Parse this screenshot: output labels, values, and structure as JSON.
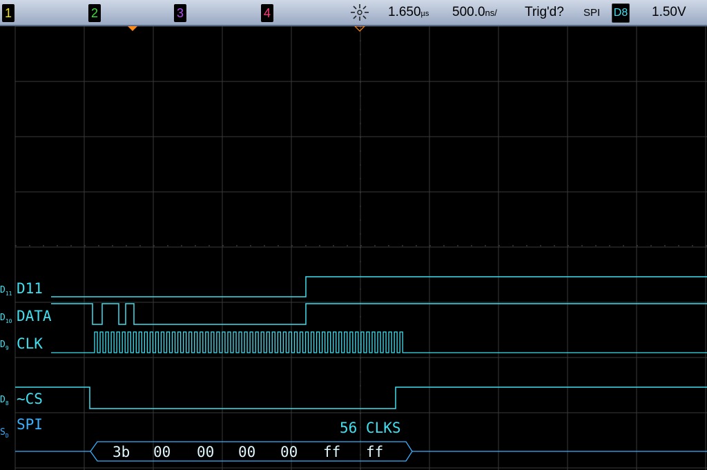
{
  "toolbar": {
    "channels": [
      {
        "label": "1",
        "color": "#f5e31a"
      },
      {
        "label": "2",
        "color": "#36e236"
      },
      {
        "label": "3",
        "color": "#b44cf0"
      },
      {
        "label": "4",
        "color": "#ff3c7d"
      }
    ],
    "delay": "1.650",
    "delay_unit": "µs",
    "timebase": "500.0",
    "timebase_unit": "ns/",
    "trigger_status": "Trig'd?",
    "trigger_type": "SPI",
    "trigger_source": "D8",
    "trigger_level": "1.50V"
  },
  "traces": {
    "d11": {
      "id": "D11",
      "label": "D11"
    },
    "d10": {
      "id": "D10",
      "label": "DATA"
    },
    "d9": {
      "id": "D9",
      "label": "CLK"
    },
    "d8": {
      "id": "D8",
      "label": "~CS"
    },
    "sd": {
      "id": "SD",
      "label": "SPI"
    }
  },
  "decode": {
    "clock_count": "56 CLKS",
    "bytes": [
      "3b",
      "00",
      "00",
      "00",
      "00",
      "ff",
      "ff"
    ]
  },
  "colors": {
    "digital": "#3fe0f0",
    "serial": "#3ab0ff",
    "grid": "#3a3a3a",
    "marker": "#ff8a1a"
  }
}
